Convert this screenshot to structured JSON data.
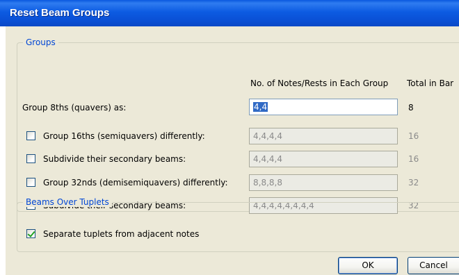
{
  "window": {
    "title": "Reset Beam Groups"
  },
  "groups": {
    "legend": "Groups",
    "col_header_notes": "No. of Notes/Rests in Each Group",
    "col_header_total": "Total in Bar",
    "rows": [
      {
        "label": "Group 8ths (quavers) as:",
        "has_checkbox": false,
        "checked": false,
        "value": "4,4",
        "total": "8"
      },
      {
        "label": "Group 16ths (semiquavers) differently:",
        "has_checkbox": true,
        "checked": false,
        "value": "4,4,4,4",
        "total": "16"
      },
      {
        "label": "Subdivide their secondary beams:",
        "has_checkbox": true,
        "checked": false,
        "value": "4,4,4,4",
        "total": "16"
      },
      {
        "label": "Group 32nds (demisemiquavers) differently:",
        "has_checkbox": true,
        "checked": false,
        "value": "8,8,8,8",
        "total": "32"
      },
      {
        "label": "Subdivide their secondary beams:",
        "has_checkbox": true,
        "checked": false,
        "value": "4,4,4,4,4,4,4,4",
        "total": "32"
      }
    ]
  },
  "tuplets": {
    "legend": "Beams Over Tuplets",
    "separate_label": "Separate tuplets from adjacent notes",
    "separate_checked": true
  },
  "buttons": {
    "ok": "OK",
    "cancel": "Cancel"
  },
  "colors": {
    "title_bar": "#0a4fd4",
    "dialog_bg": "#ece9d8",
    "legend_text": "#0046d5",
    "selection": "#316ac5"
  }
}
